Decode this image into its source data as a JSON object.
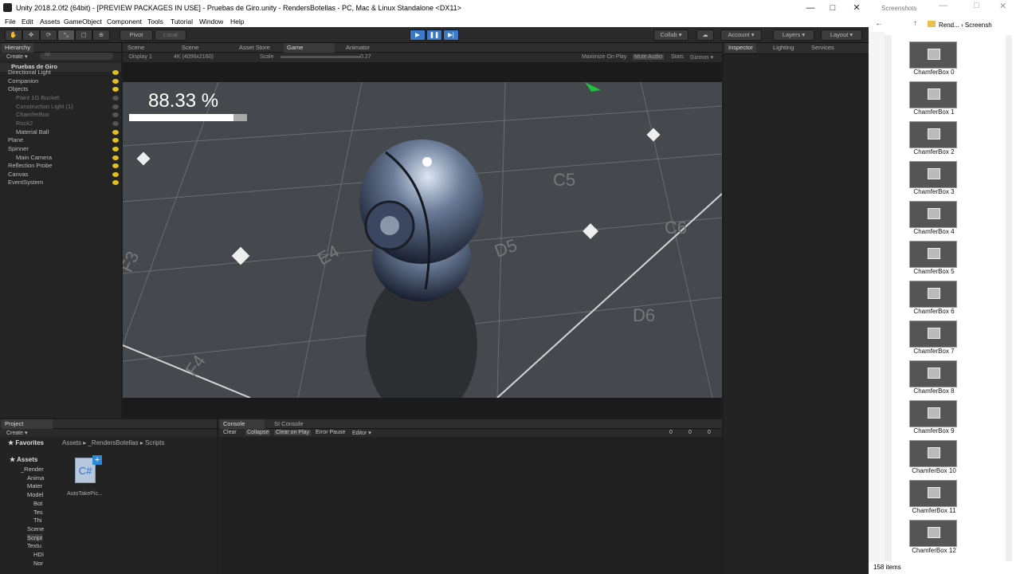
{
  "window": {
    "title": "Unity 2018.2.0f2 (64bit) - [PREVIEW PACKAGES IN USE] - Pruebas de Giro.unity - RendersBotellas - PC, Mac & Linux Standalone <DX11>",
    "minimize": "—",
    "maximize": "□",
    "close": "✕"
  },
  "menu": [
    "File",
    "Edit",
    "Assets",
    "GameObject",
    "Component",
    "Tools",
    "Tutorial",
    "Window",
    "Help"
  ],
  "toolbar": {
    "pivot": "Pivot",
    "local": "Local",
    "collab": "Collab ▾",
    "account": "Account ▾",
    "layers": "Layers ▾",
    "layout": "Layout ▾"
  },
  "hierarchy": {
    "tab": "Hierarchy",
    "create": "Create ▾",
    "search": "All",
    "scene": "Pruebas de Giro",
    "items": [
      {
        "label": "Directional Light",
        "indent": 1,
        "dim": false
      },
      {
        "label": "Companion",
        "indent": 1,
        "dim": false
      },
      {
        "label": "Objects",
        "indent": 1,
        "dim": false
      },
      {
        "label": "Paint 1G Bucket",
        "indent": 2,
        "dim": true
      },
      {
        "label": "Construction Light (1)",
        "indent": 2,
        "dim": true
      },
      {
        "label": "ChamferBox",
        "indent": 2,
        "dim": true
      },
      {
        "label": "Rock2",
        "indent": 2,
        "dim": true
      },
      {
        "label": "Material Ball",
        "indent": 2,
        "dim": false
      },
      {
        "label": "Plane",
        "indent": 1,
        "dim": false
      },
      {
        "label": "Spinner",
        "indent": 1,
        "dim": false
      },
      {
        "label": "Main Camera",
        "indent": 2,
        "dim": false
      },
      {
        "label": "Reflection Probe",
        "indent": 1,
        "dim": false
      },
      {
        "label": "Canvas",
        "indent": 1,
        "dim": false
      },
      {
        "label": "EventSystem",
        "indent": 1,
        "dim": false
      }
    ]
  },
  "center_tabs": {
    "scene1": "Scene",
    "scene2": "Scene",
    "asset_store": "Asset Store",
    "game": "Game",
    "animator": "Animator"
  },
  "gamebar": {
    "display": "Display 1",
    "resolution": "4K (4096x2160)",
    "scale_label": "Scale",
    "scale_value": "0.27",
    "maximize": "Maximize On Play",
    "mute": "Mute Audio",
    "stats": "Stats",
    "gizmos": "Gizmos ▾"
  },
  "game": {
    "progress_text": "88.33 %",
    "progress": 0.8833
  },
  "inspector": {
    "tab": "Inspector",
    "lighting": "Lighting",
    "services": "Services"
  },
  "project": {
    "tab": "Project",
    "create": "Create ▾",
    "favorites": "Favorites",
    "breadcrumb": "Assets ▸ _RendersBotellas ▸ Scripts",
    "assets": "Assets",
    "tree": [
      "_Render",
      "Anima",
      "Mater",
      "Model",
      "Bot",
      "Tes",
      "Thi",
      "Scene",
      "Script",
      "Textu",
      "HDI",
      "Nor"
    ],
    "file": "AutoTakePic..."
  },
  "console": {
    "tab": "Console",
    "si": "SI Console",
    "clear": "Clear",
    "collapse": "Collapse",
    "clear_on_play": "Clear on Play",
    "error_pause": "Error Pause",
    "editor": "Editor ▾",
    "count_info": "0",
    "count_warn": "0",
    "count_err": "0"
  },
  "explorer": {
    "title": "Screenshots",
    "path": "Rend... ›  Screensh",
    "count": "158 items",
    "items": [
      "ChamferBox 0",
      "ChamferBox 1",
      "ChamferBox 2",
      "ChamferBox 3",
      "ChamferBox 4",
      "ChamferBox 5",
      "ChamferBox 6",
      "ChamferBox 7",
      "ChamferBox 8",
      "ChamferBox 9",
      "ChamferBox 10",
      "ChamferBox 11",
      "ChamferBox 12"
    ]
  }
}
